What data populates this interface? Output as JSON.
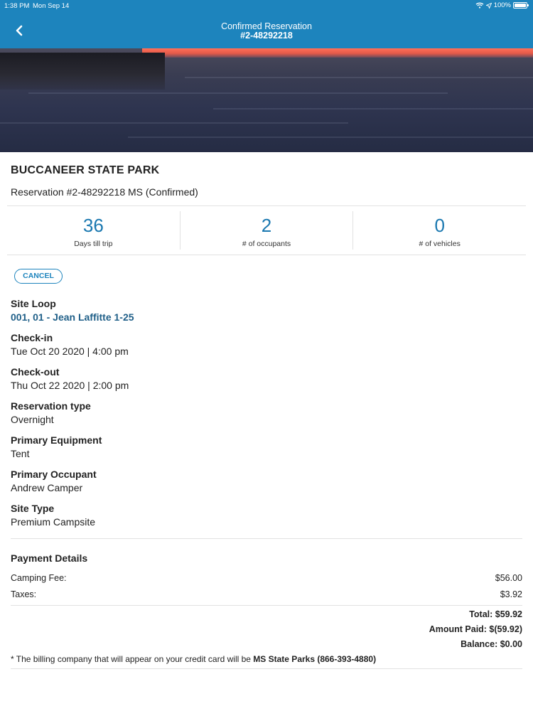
{
  "status_bar": {
    "time": "1:38 PM",
    "date": "Mon Sep 14",
    "battery": "100%"
  },
  "nav": {
    "title_line1": "Confirmed Reservation",
    "title_line2": "#2-48292218"
  },
  "header": {
    "park_name": "BUCCANEER STATE PARK",
    "reservation_line": "Reservation #2-48292218 MS (Confirmed)"
  },
  "stats": [
    {
      "value": "36",
      "label": "Days till trip"
    },
    {
      "value": "2",
      "label": "# of occupants"
    },
    {
      "value": "0",
      "label": "# of vehicles"
    }
  ],
  "cancel_label": "CANCEL",
  "details": {
    "site_loop": {
      "label": "Site Loop",
      "value": "001, 01 - Jean Laffitte 1-25"
    },
    "check_in": {
      "label": "Check-in",
      "value": "Tue Oct 20 2020 | 4:00 pm"
    },
    "check_out": {
      "label": "Check-out",
      "value": "Thu Oct 22 2020 | 2:00 pm"
    },
    "reservation_type": {
      "label": "Reservation type",
      "value": "Overnight"
    },
    "primary_equipment": {
      "label": "Primary Equipment",
      "value": "Tent"
    },
    "primary_occupant": {
      "label": "Primary Occupant",
      "value": "Andrew Camper"
    },
    "site_type": {
      "label": "Site Type",
      "value": "Premium Campsite"
    }
  },
  "payment": {
    "title": "Payment Details",
    "camping_fee_label": "Camping Fee:",
    "camping_fee": "$56.00",
    "taxes_label": "Taxes:",
    "taxes": "$3.92",
    "total": "Total: $59.92",
    "amount_paid": "Amount Paid: $(59.92)",
    "balance": "Balance: $0.00",
    "note_prefix": "* The billing company that will appear on your credit card will be ",
    "note_company": "MS State Parks (866-393-4880)"
  },
  "colors": {
    "nav_bar": "#1d84bd",
    "accent_number": "#1a78b0",
    "link": "#1f5f88"
  },
  "icons": {
    "back": "chevron-left-icon",
    "wifi": "wifi-icon",
    "location": "location-arrow-icon",
    "battery": "battery-icon"
  }
}
